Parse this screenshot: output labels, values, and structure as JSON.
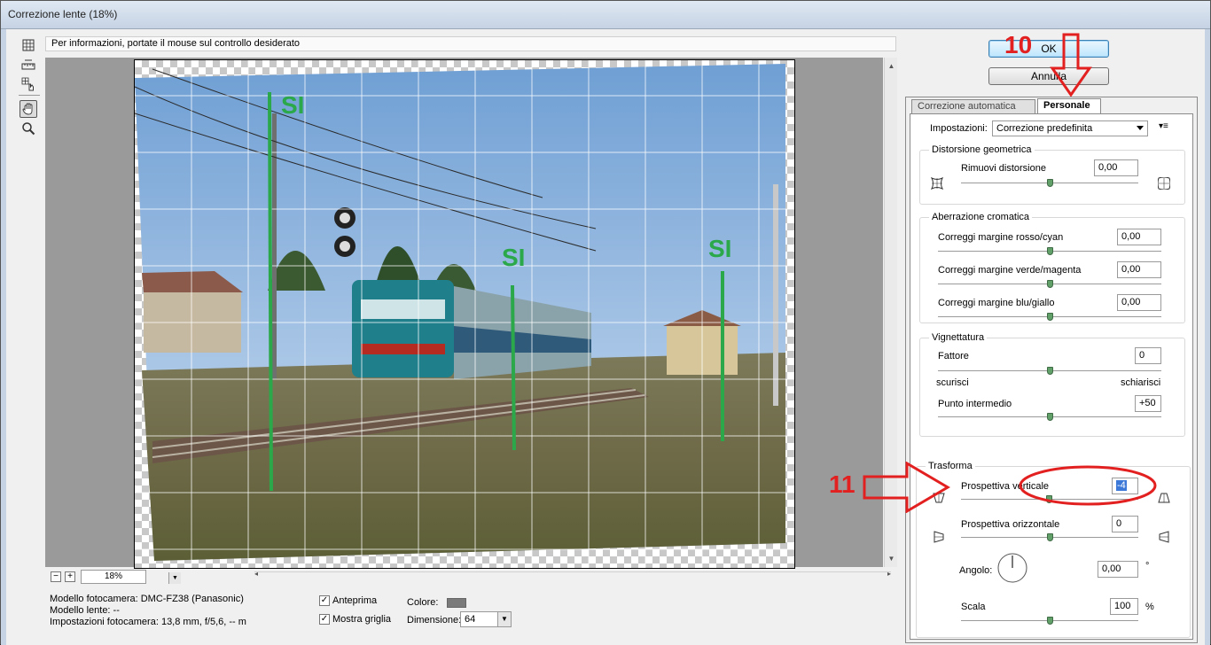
{
  "window": {
    "title": "Correzione lente (18%)"
  },
  "info_bar": {
    "text": "Per informazioni, portate il mouse sul controllo desiderato"
  },
  "tools": [
    "remove-distortion-tool-icon",
    "straighten-tool-icon",
    "move-grid-tool-icon",
    "hand-tool-icon",
    "zoom-tool-icon"
  ],
  "preview": {
    "annotations": [
      "SI",
      "SI",
      "SI"
    ],
    "zoom": "18%"
  },
  "camera_info": {
    "model": "Modello fotocamera: DMC-FZ38 (Panasonic)",
    "lens": "Modello lente: --",
    "settings": "Impostazioni fotocamera: 13,8 mm, f/5,6, -- m"
  },
  "options": {
    "preview_label": "Anteprima",
    "preview_checked": true,
    "grid_label": "Mostra griglia",
    "grid_checked": true,
    "color_label": "Colore:",
    "grid_color": "#7a7a7a",
    "size_label": "Dimensione:",
    "size_value": "64"
  },
  "buttons": {
    "ok": "OK",
    "cancel": "Annulla"
  },
  "tabs": {
    "auto": "Correzione automatica",
    "custom": "Personale"
  },
  "custom": {
    "settings_label": "Impostazioni:",
    "settings_value": "Correzione predefinita",
    "geometric": {
      "title": "Distorsione geometrica",
      "remove_label": "Rimuovi distorsione",
      "remove_value": "0,00"
    },
    "chromatic": {
      "title": "Aberrazione cromatica",
      "red_cyan_label": "Correggi margine rosso/cyan",
      "red_cyan_value": "0,00",
      "green_magenta_label": "Correggi margine verde/magenta",
      "green_magenta_value": "0,00",
      "blue_yellow_label": "Correggi margine blu/giallo",
      "blue_yellow_value": "0,00"
    },
    "vignette": {
      "title": "Vignettatura",
      "amount_label": "Fattore",
      "amount_value": "0",
      "darken_label": "scurisci",
      "lighten_label": "schiarisci",
      "midpoint_label": "Punto intermedio",
      "midpoint_value": "+50"
    },
    "transform": {
      "title": "Trasforma",
      "vertical_label": "Prospettiva verticale",
      "vertical_value": "-4",
      "horizontal_label": "Prospettiva orizzontale",
      "horizontal_value": "0",
      "angle_label": "Angolo:",
      "angle_value": "0,00",
      "angle_unit": "°",
      "scale_label": "Scala",
      "scale_value": "100",
      "scale_unit": "%"
    }
  },
  "annotation_numbers": {
    "step10": "10",
    "step11": "11"
  },
  "colors": {
    "annotation_green": "#2aa84a",
    "annotation_red": "#e32020",
    "thumb_green": "#62a06a"
  }
}
